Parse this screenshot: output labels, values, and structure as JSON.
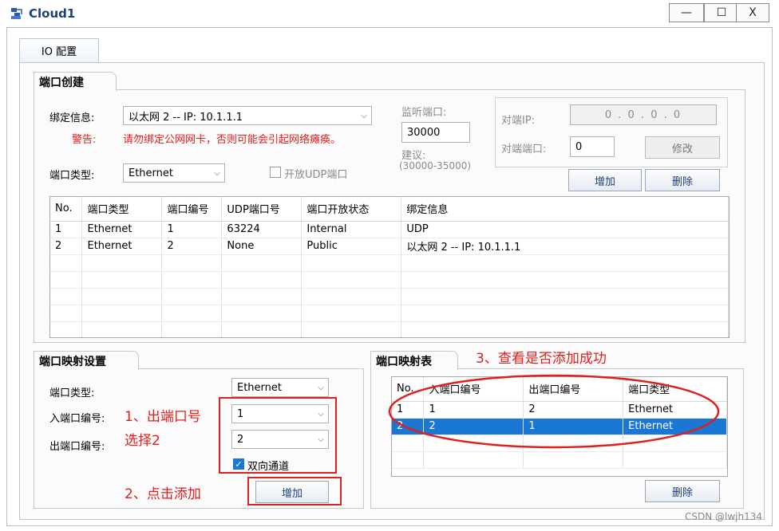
{
  "window": {
    "title": "Cloud1",
    "minimize": "—",
    "maximize": "☐",
    "close": "X"
  },
  "tab": {
    "label": "IO 配置"
  },
  "port_create": {
    "title": "端口创建",
    "bind_label": "绑定信息:",
    "bind_value": "以太网 2 -- IP: 10.1.1.1",
    "warn_label": "警告:",
    "warn_text": "请勿绑定公网网卡，否则可能会引起网络瘫痪。",
    "type_label": "端口类型:",
    "type_value": "Ethernet",
    "udp_checkbox": "开放UDP端口",
    "listen_label": "监听端口:",
    "listen_value": "30000",
    "suggest_label": "建议:",
    "suggest_range": "(30000-35000)",
    "peer_ip_label": "对端IP:",
    "peer_ip_value": "0 . 0 . 0 . 0",
    "peer_port_label": "对端端口:",
    "peer_port_value": "0",
    "modify_button": "修改",
    "add_button": "增加",
    "delete_button": "删除",
    "table": {
      "headers": [
        "No.",
        "端口类型",
        "端口编号",
        "UDP端口号",
        "端口开放状态",
        "绑定信息"
      ],
      "rows": [
        [
          "1",
          "Ethernet",
          "1",
          "63224",
          "Internal",
          "UDP"
        ],
        [
          "2",
          "Ethernet",
          "2",
          "None",
          "Public",
          "以太网 2 -- IP: 10.1.1.1"
        ]
      ]
    }
  },
  "mapping_settings": {
    "title": "端口映射设置",
    "type_label": "端口类型:",
    "type_value": "Ethernet",
    "in_label": "入端口编号:",
    "in_value": "1",
    "out_label": "出端口编号:",
    "out_value": "2",
    "bidirectional": "双向通道",
    "add_button": "增加"
  },
  "mapping_table": {
    "title": "端口映射表",
    "headers": [
      "No.",
      "入端口编号",
      "出端口编号",
      "端口类型"
    ],
    "rows": [
      [
        "1",
        "1",
        "2",
        "Ethernet"
      ],
      [
        "2",
        "2",
        "1",
        "Ethernet"
      ]
    ],
    "delete_button": "删除"
  },
  "annotations": {
    "a1_line1": "1、出端口号",
    "a1_line2": "选择2",
    "a2": "2、点击添加",
    "a3": "3、查看是否添加成功",
    "color": "#e0201c"
  },
  "watermark": "CSDN @lwjh134"
}
